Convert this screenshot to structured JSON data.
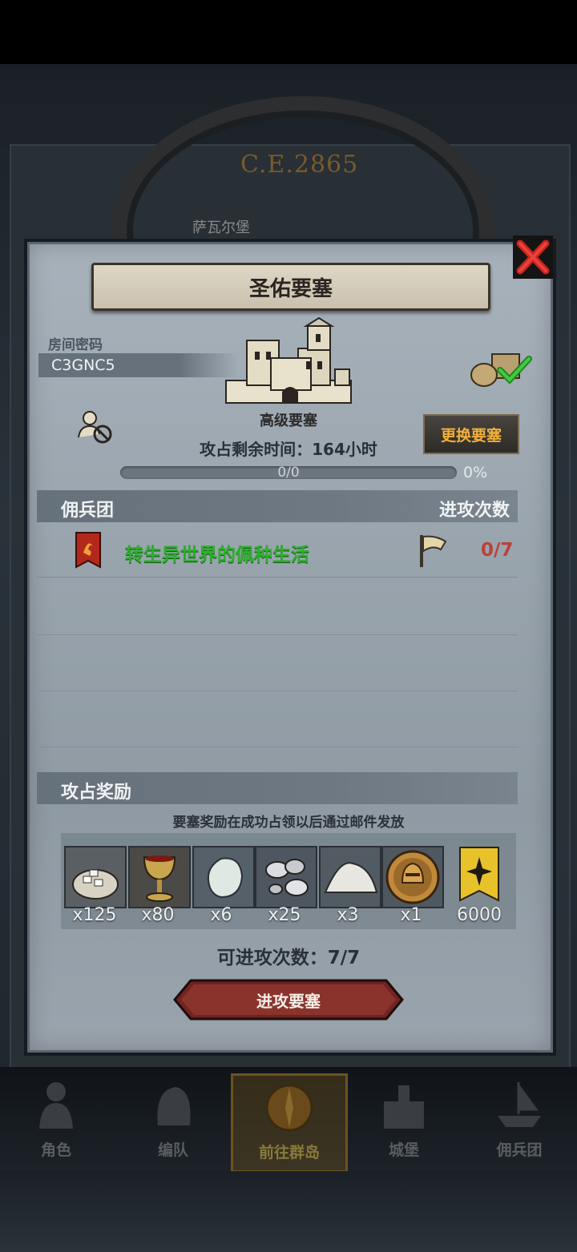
{
  "background": {
    "era_label": "C.E.2865",
    "place_label": "萨瓦尔堡"
  },
  "dialog": {
    "title": "圣佑要塞",
    "room_code_label": "房间密码",
    "room_code": "C3GNC5",
    "fortress_level": "高级要塞",
    "change_button": "更换要塞",
    "time_remaining": "攻占剩余时间：164小时",
    "progress": {
      "text": "0/0",
      "percent_text": "0%",
      "value": 0
    },
    "mercenary_header": "佣兵团",
    "attack_count_header": "进攻次数",
    "mercenaries": [
      {
        "name": "转生异世界的佩种生活",
        "attacks": "0/7"
      }
    ],
    "reward_header": "攻占奖励",
    "reward_note": "要塞奖励在成功占领以后通过邮件发放",
    "rewards": [
      {
        "icon": "ore-sack-icon",
        "qty": "x125"
      },
      {
        "icon": "goblet-icon",
        "qty": "x80"
      },
      {
        "icon": "moonstone-icon",
        "qty": "x6"
      },
      {
        "icon": "silver-nuggets-icon",
        "qty": "x25"
      },
      {
        "icon": "salt-pile-icon",
        "qty": "x3"
      },
      {
        "icon": "knight-helmet-coin-icon",
        "qty": "x1"
      },
      {
        "icon": "gold-banner-icon",
        "qty": "6000"
      }
    ],
    "attacks_available": "可进攻次数：7/7",
    "attack_button": "进攻要塞"
  },
  "nav": [
    {
      "label": "角色",
      "icon": "knight-icon"
    },
    {
      "label": "编队",
      "icon": "helmet-icon"
    },
    {
      "label": "前往群岛",
      "icon": "compass-icon",
      "active": true
    },
    {
      "label": "城堡",
      "icon": "castle-icon"
    },
    {
      "label": "佣兵团",
      "icon": "ship-icon"
    }
  ]
}
